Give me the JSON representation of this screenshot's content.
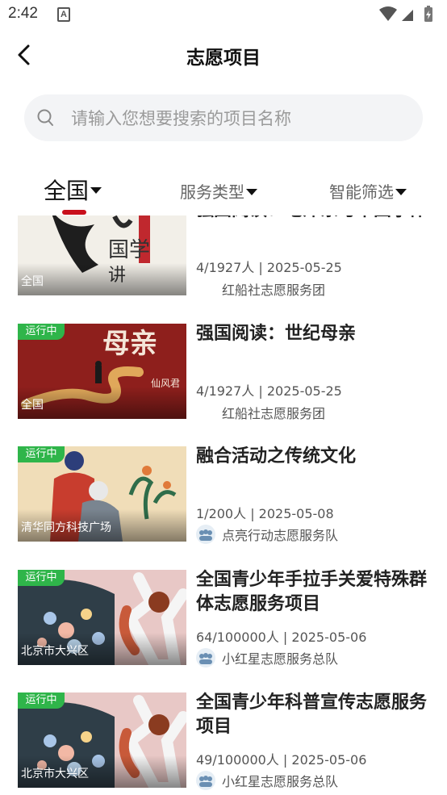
{
  "status_bar": {
    "time": "2:42",
    "notification_badge": "A"
  },
  "header": {
    "title": "志愿项目"
  },
  "search": {
    "placeholder": "请输入您想要搜索的项目名称"
  },
  "filters": [
    {
      "label": "全国",
      "active": true
    },
    {
      "label": "服务类型",
      "active": false
    },
    {
      "label": "智能筛选",
      "active": false
    }
  ],
  "projects": [
    {
      "title": "强国阅读：毛泽东与中国字体",
      "status": "",
      "location": "全国",
      "participants": "4/1927人",
      "date": "2025-05-25",
      "meta": "4/1927人  |  2025-05-25",
      "organization": "红船社志愿服务团",
      "thumb_icon": "book-cover-guoxue-image"
    },
    {
      "title": "强国阅读：世纪母亲",
      "status": "运行中",
      "location": "全国",
      "participants": "4/1927人",
      "date": "2025-05-25",
      "meta": "4/1927人  |  2025-05-25",
      "organization": "红船社志愿服务团",
      "thumb_icon": "book-cover-mother-image"
    },
    {
      "title": "融合活动之传统文化",
      "status": "运行中",
      "location": "清华同方科技广场",
      "participants": "1/200人",
      "date": "2025-05-08",
      "meta": "1/200人  |  2025-05-08",
      "organization": "点亮行动志愿服务队",
      "thumb_icon": "haircut-illustration-image"
    },
    {
      "title": "全国青少年手拉手关爱特殊群体志愿服务项目",
      "status": "运行中",
      "location": "北京市大兴区",
      "participants": "64/100000人",
      "date": "2025-05-06",
      "meta": "64/100000人  |  2025-05-06",
      "organization": "小红星志愿服务总队",
      "thumb_icon": "youth-celebration-image"
    },
    {
      "title": "全国青少年科普宣传志愿服务项目",
      "status": "运行中",
      "location": "北京市大兴区",
      "participants": "49/100000人",
      "date": "2025-05-06",
      "meta": "49/100000人  |  2025-05-06",
      "organization": "小红星志愿服务总队",
      "thumb_icon": "youth-celebration-image"
    }
  ],
  "colors": {
    "accent": "#c8101c",
    "status_green": "#2fb54a",
    "search_bg": "#f3f4f6"
  }
}
